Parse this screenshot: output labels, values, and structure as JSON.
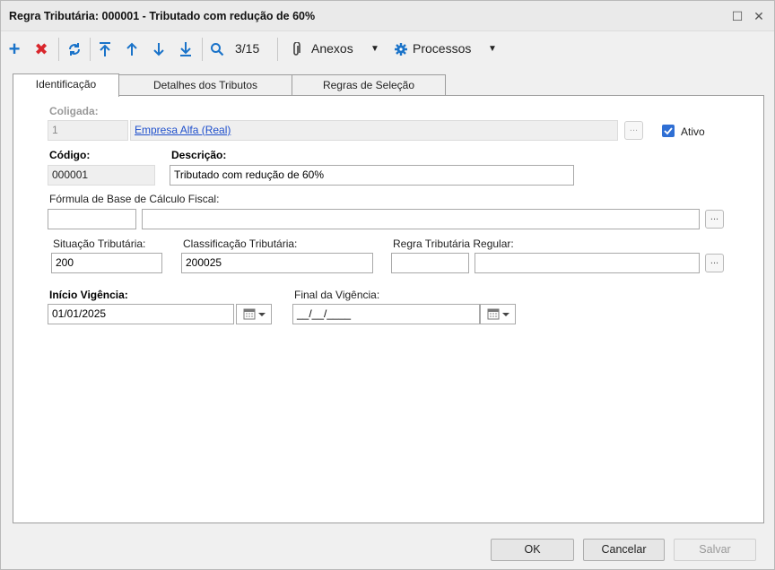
{
  "window": {
    "title": "Regra Tributária: 000001 - Tributado com redução de 60%",
    "maximize_glyph": "☐",
    "close_glyph": "✕"
  },
  "toolbar": {
    "record_position": "3/15",
    "attachments_label": "Anexos",
    "processes_label": "Processos",
    "icons": [
      "add-icon",
      "delete-icon",
      "refresh-icon",
      "first-record-icon",
      "previous-record-icon",
      "next-record-icon",
      "last-record-icon",
      "search-icon",
      "paperclip-icon",
      "gear-icon"
    ]
  },
  "tabs": [
    {
      "label": "Identificação",
      "active": true
    },
    {
      "label": "Detalhes dos Tributos",
      "active": false
    },
    {
      "label": "Regras de Seleção",
      "active": false
    }
  ],
  "form": {
    "coligada": {
      "label": "Coligada:",
      "code": "1",
      "name": "Empresa Alfa (Real)"
    },
    "ativo": {
      "label": "Ativo",
      "checked": true
    },
    "codigo": {
      "label": "Código:",
      "value": "000001"
    },
    "descricao": {
      "label": "Descrição:",
      "value": "Tributado com redução de 60%"
    },
    "formula": {
      "label": "Fórmula de Base de Cálculo Fiscal:",
      "code": "",
      "description": ""
    },
    "situacao": {
      "label": "Situação Tributária:",
      "value": "200"
    },
    "classificacao": {
      "label": "Classificação Tributária:",
      "value": "200025"
    },
    "regra_regular": {
      "label": "Regra Tributária Regular:",
      "code": "",
      "description": ""
    },
    "inicio_vigencia": {
      "label": "Início Vigência:",
      "value": "01/01/2025"
    },
    "final_vigencia": {
      "label": "Final da Vigência:",
      "value": "__/__/____"
    },
    "lookup_label": "..."
  },
  "footer": {
    "ok_label": "OK",
    "cancel_label": "Cancelar",
    "save_label": "Salvar"
  },
  "colors": {
    "accent": "#1a73c9",
    "delete": "#d9262c",
    "link": "#1e4fcc",
    "checkbox": "#2f6fd4"
  }
}
